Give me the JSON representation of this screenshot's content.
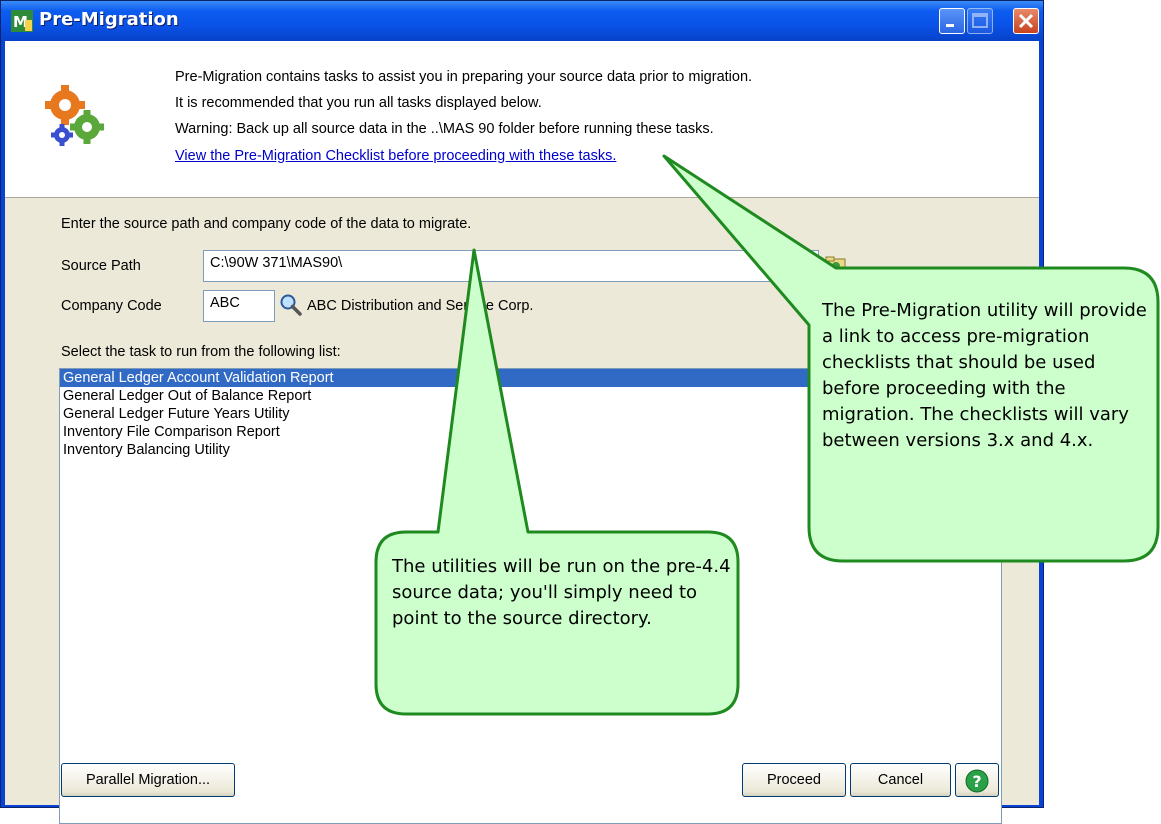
{
  "window": {
    "title": "Pre-Migration"
  },
  "header": {
    "line1": "Pre-Migration contains tasks to assist you in preparing your source data prior to migration.",
    "line2": "It is recommended that you run all tasks displayed below.",
    "line3": "Warning: Back up all source data in the ..\\MAS 90 folder before running these tasks.",
    "checklist_link": "View the Pre-Migration Checklist before proceeding with these tasks."
  },
  "form": {
    "instructions": "Enter the source path and company code of the data to migrate.",
    "source_path_label": "Source Path",
    "source_path_value": "C:\\90W 371\\MAS90\\",
    "company_code_label": "Company Code",
    "company_code_value": "ABC",
    "company_name": "ABC Distribution and Service Corp."
  },
  "tasks": {
    "label": "Select the task to run from the following list:",
    "items": [
      "General Ledger Account Validation Report",
      "General Ledger Out of Balance Report",
      "General Ledger Future Years Utility",
      "Inventory File Comparison Report",
      "Inventory Balancing Utility"
    ],
    "selected_index": 0
  },
  "buttons": {
    "parallel_migration": "Parallel Migration...",
    "proceed": "Proceed",
    "cancel": "Cancel"
  },
  "callouts": {
    "checklist_note": "The Pre-Migration utility will provide a link to access pre-migration checklists that should be used before proceeding with the migration. The checklists will vary between versions 3.x and 4.x.",
    "utilities_note": "The utilities will be run on the pre-4.4 source data; you'll simply need to point to the source directory."
  },
  "colors": {
    "title_bar": "#0a52e8",
    "dialog_face": "#ece9d8",
    "selection": "#316ac5",
    "callout_fill": "#ccffcc",
    "callout_border": "#1f8a1f",
    "link": "#0000cc"
  },
  "icons": [
    "app-icon",
    "gears-icon",
    "minimize-icon",
    "maximize-icon",
    "close-icon",
    "folder-browse-icon",
    "lookup-magnifier-icon",
    "help-icon"
  ]
}
